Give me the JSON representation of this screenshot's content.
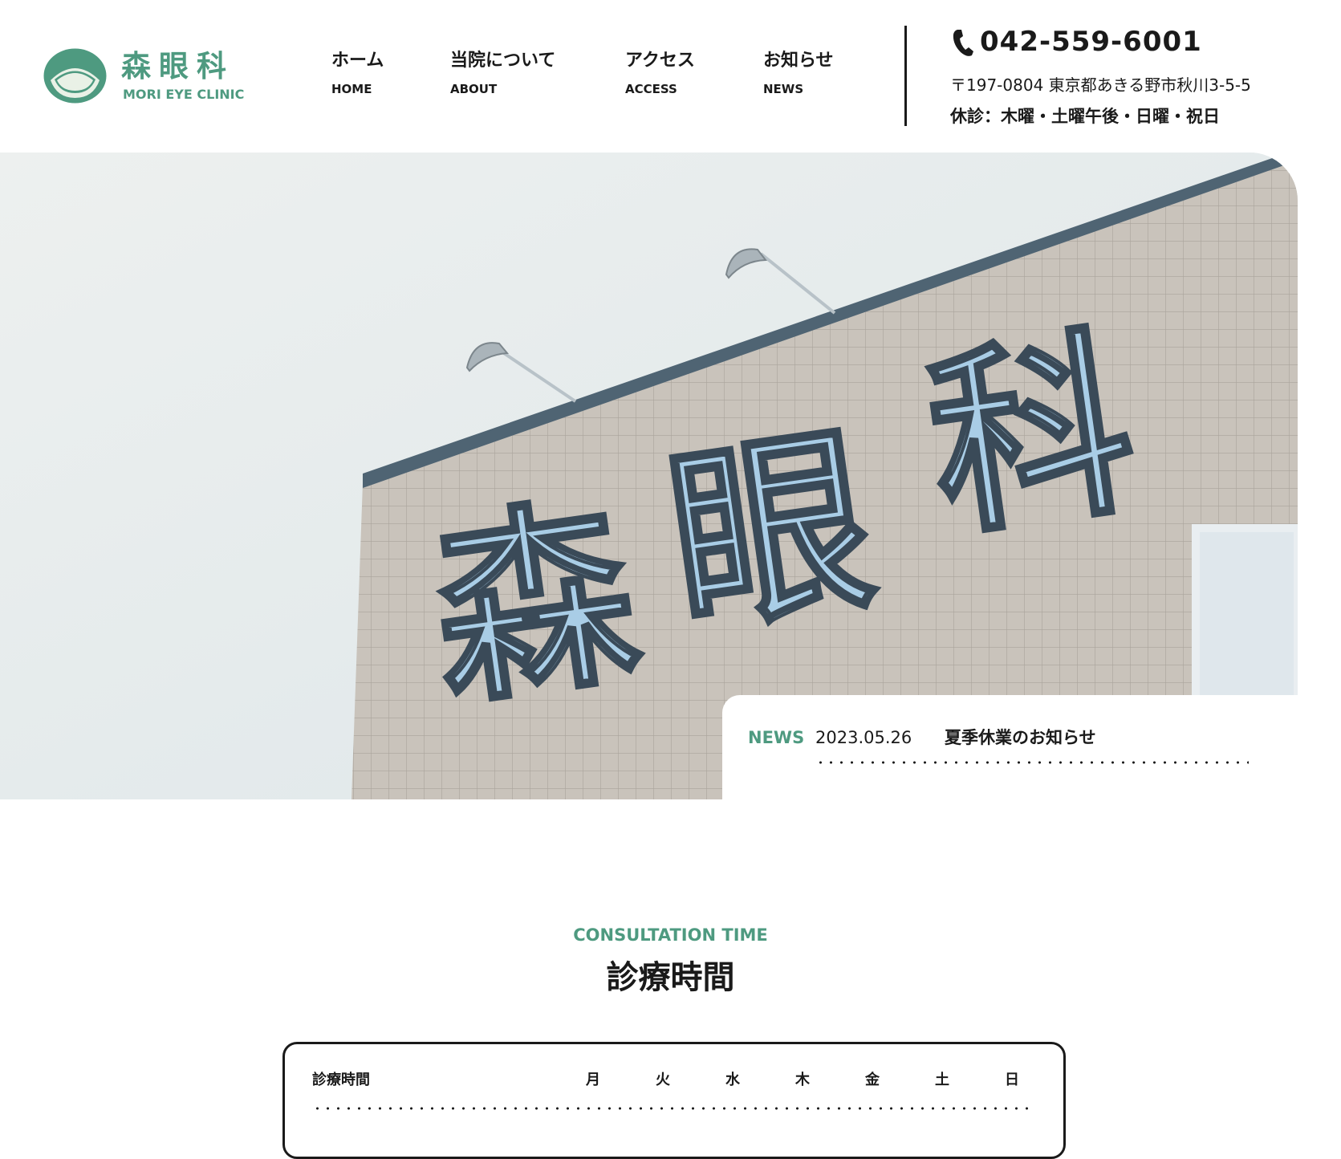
{
  "brand": {
    "name_jp": "森眼科",
    "name_en": "MORI EYE CLINIC",
    "color": "#4e9a80"
  },
  "nav": [
    {
      "jp": "ホーム",
      "en": "HOME"
    },
    {
      "jp": "当院について",
      "en": "ABOUT"
    },
    {
      "jp": "アクセス",
      "en": "ACCESS"
    },
    {
      "jp": "お知らせ",
      "en": "NEWS"
    }
  ],
  "contact": {
    "phone_icon": "phone-icon",
    "phone": "042-559-6001",
    "address": "〒197-0804 東京都あきる野市秋川3-5-5",
    "closed": "休診：木曜・土曜午後・日曜・祝日"
  },
  "hero": {
    "sign_text": [
      "森",
      "眼",
      "科"
    ]
  },
  "news": {
    "label": "NEWS",
    "date": "2023.05.26",
    "title": "夏季休業のお知らせ"
  },
  "consultation": {
    "heading_en": "CONSULTATION TIME",
    "heading_jp": "診療時間",
    "table": {
      "header": "診療時間",
      "days": [
        "月",
        "火",
        "水",
        "木",
        "金",
        "土",
        "日"
      ]
    }
  }
}
